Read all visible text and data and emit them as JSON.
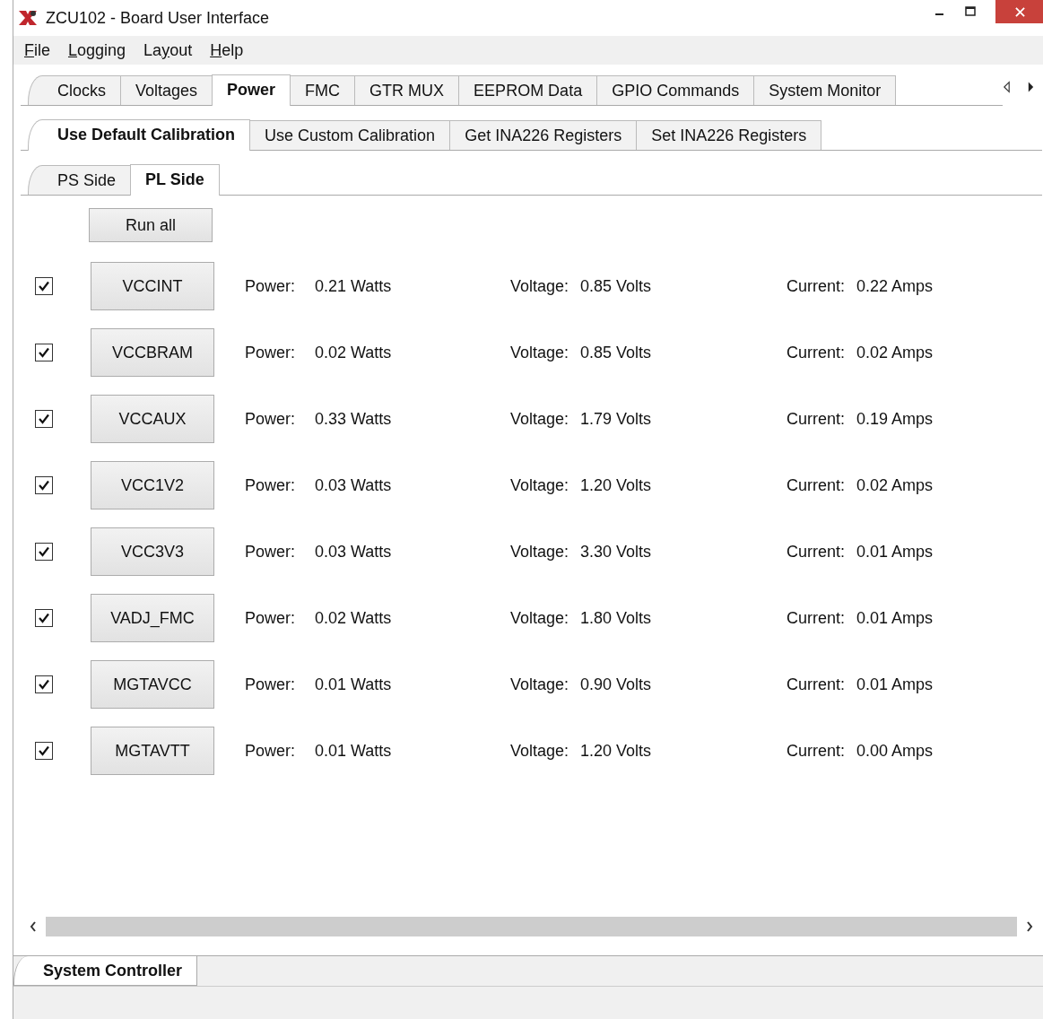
{
  "window": {
    "title": "ZCU102 - Board User Interface"
  },
  "menu": [
    {
      "key": "F",
      "post": "ile"
    },
    {
      "key": "L",
      "post": "ogging"
    },
    {
      "pre": "La",
      "key": "y",
      "post": "out"
    },
    {
      "key": "H",
      "post": "elp"
    }
  ],
  "tabs": [
    {
      "label": "Clocks",
      "selected": false
    },
    {
      "label": "Voltages",
      "selected": false
    },
    {
      "label": "Power",
      "selected": true
    },
    {
      "label": "FMC",
      "selected": false
    },
    {
      "label": "GTR MUX",
      "selected": false
    },
    {
      "label": "EEPROM Data",
      "selected": false
    },
    {
      "label": "GPIO Commands",
      "selected": false
    },
    {
      "label": "System Monitor",
      "selected": false
    }
  ],
  "calibration_tabs": [
    {
      "label": "Use Default Calibration",
      "selected": true
    },
    {
      "label": "Use Custom Calibration",
      "selected": false
    },
    {
      "label": "Get INA226 Registers",
      "selected": false
    },
    {
      "label": "Set INA226 Registers",
      "selected": false
    }
  ],
  "side_tabs": [
    {
      "label": "PS Side",
      "selected": false
    },
    {
      "label": "PL Side",
      "selected": true
    }
  ],
  "run_all_button": "Run all",
  "rails": [
    {
      "name": "VCCINT",
      "checked": true,
      "power_label": "Power:",
      "power": "0.21 Watts",
      "voltage_label": "Voltage:",
      "voltage": "0.85 Volts",
      "current_label": "Current:",
      "current": "0.22 Amps"
    },
    {
      "name": "VCCBRAM",
      "checked": true,
      "power_label": "Power:",
      "power": "0.02 Watts",
      "voltage_label": "Voltage:",
      "voltage": "0.85 Volts",
      "current_label": "Current:",
      "current": "0.02 Amps"
    },
    {
      "name": "VCCAUX",
      "checked": true,
      "power_label": "Power:",
      "power": "0.33 Watts",
      "voltage_label": "Voltage:",
      "voltage": "1.79 Volts",
      "current_label": "Current:",
      "current": "0.19 Amps"
    },
    {
      "name": "VCC1V2",
      "checked": true,
      "power_label": "Power:",
      "power": "0.03 Watts",
      "voltage_label": "Voltage:",
      "voltage": "1.20 Volts",
      "current_label": "Current:",
      "current": "0.02 Amps"
    },
    {
      "name": "VCC3V3",
      "checked": true,
      "power_label": "Power:",
      "power": "0.03 Watts",
      "voltage_label": "Voltage:",
      "voltage": "3.30 Volts",
      "current_label": "Current:",
      "current": "0.01 Amps"
    },
    {
      "name": "VADJ_FMC",
      "checked": true,
      "power_label": "Power:",
      "power": "0.02 Watts",
      "voltage_label": "Voltage:",
      "voltage": "1.80 Volts",
      "current_label": "Current:",
      "current": "0.01 Amps"
    },
    {
      "name": "MGTAVCC",
      "checked": true,
      "power_label": "Power:",
      "power": "0.01 Watts",
      "voltage_label": "Voltage:",
      "voltage": "0.90 Volts",
      "current_label": "Current:",
      "current": "0.01 Amps"
    },
    {
      "name": "MGTAVTT",
      "checked": true,
      "power_label": "Power:",
      "power": "0.01 Watts",
      "voltage_label": "Voltage:",
      "voltage": "1.20 Volts",
      "current_label": "Current:",
      "current": "0.00 Amps"
    }
  ],
  "bottom_tabs": [
    {
      "label": "System Controller",
      "selected": true
    }
  ]
}
